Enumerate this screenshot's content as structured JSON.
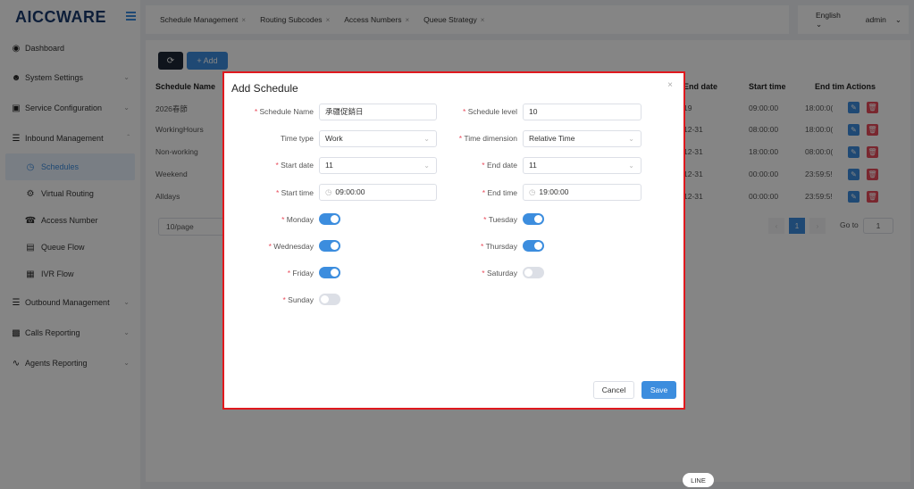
{
  "logo": {
    "text": "AICCWARE"
  },
  "sidebar": {
    "items": [
      {
        "label": "Dashboard",
        "icon": "dashboard-icon"
      },
      {
        "label": "System Settings",
        "icon": "users-icon"
      },
      {
        "label": "Service Configuration",
        "icon": "config-icon"
      },
      {
        "label": "Inbound Management",
        "icon": "list-icon"
      },
      {
        "label": "Outbound Management",
        "icon": "list-icon"
      },
      {
        "label": "Calls Reporting",
        "icon": "bar-chart-icon"
      },
      {
        "label": "Agents Reporting",
        "icon": "line-chart-icon"
      }
    ],
    "sub_items": [
      {
        "label": "Schedules",
        "icon": "clock-icon"
      },
      {
        "label": "Virtual Routing",
        "icon": "gear-icon"
      },
      {
        "label": "Access Number",
        "icon": "phone-icon"
      },
      {
        "label": "Queue Flow",
        "icon": "queue-icon"
      },
      {
        "label": "IVR Flow",
        "icon": "ivr-icon"
      }
    ]
  },
  "tabs": [
    {
      "label": "Schedule Management"
    },
    {
      "label": "Routing Subcodes"
    },
    {
      "label": "Access Numbers"
    },
    {
      "label": "Queue Strategy"
    }
  ],
  "topbar": {
    "language": "English",
    "user": "admin"
  },
  "toolbar": {
    "add_label": "+ Add"
  },
  "table": {
    "headers": {
      "name": "Schedule Name",
      "end_date": "End date",
      "start_time": "Start time",
      "end_time": "End tim",
      "actions": "Actions"
    },
    "rows": [
      {
        "name": "2026春節",
        "end_date": "19",
        "start_time": "09:00:00",
        "end_time": "18:00:0("
      },
      {
        "name": "WorkingHours",
        "end_date": "12-31",
        "start_time": "08:00:00",
        "end_time": "18:00:0("
      },
      {
        "name": "Non-working",
        "end_date": "12-31",
        "start_time": "18:00:00",
        "end_time": "08:00:0("
      },
      {
        "name": "Weekend",
        "end_date": "12-31",
        "start_time": "00:00:00",
        "end_time": "23:59:5!"
      },
      {
        "name": "Alldays",
        "end_date": "12-31",
        "start_time": "00:00:00",
        "end_time": "23:59:5!"
      }
    ]
  },
  "pager": {
    "size": "10/page",
    "page": "1",
    "goto_label": "Go to",
    "goto_value": "1"
  },
  "dialog": {
    "title": "Add Schedule",
    "fields": {
      "schedule_name": {
        "label": "Schedule Name",
        "value": "承疆促銷日"
      },
      "schedule_level": {
        "label": "Schedule level",
        "value": "10"
      },
      "time_type": {
        "label": "Time type",
        "value": "Work"
      },
      "time_dimension": {
        "label": "Time dimension",
        "value": "Relative Time"
      },
      "start_date": {
        "label": "Start date",
        "value": "11"
      },
      "end_date": {
        "label": "End date",
        "value": "11"
      },
      "start_time": {
        "label": "Start time",
        "value": "09:00:00"
      },
      "end_time": {
        "label": "End time",
        "value": "19:00:00"
      }
    },
    "days": {
      "monday": {
        "label": "Monday",
        "on": true
      },
      "tuesday": {
        "label": "Tuesday",
        "on": true
      },
      "wednesday": {
        "label": "Wednesday",
        "on": true
      },
      "thursday": {
        "label": "Thursday",
        "on": true
      },
      "friday": {
        "label": "Friday",
        "on": true
      },
      "saturday": {
        "label": "Saturday",
        "on": false
      },
      "sunday": {
        "label": "Sunday",
        "on": false
      }
    },
    "cancel_label": "Cancel",
    "save_label": "Save"
  },
  "line_badge": "LINE",
  "colors": {
    "accent": "#3c8dde",
    "danger": "#e94b5b",
    "dialog_border": "#e0191e"
  }
}
